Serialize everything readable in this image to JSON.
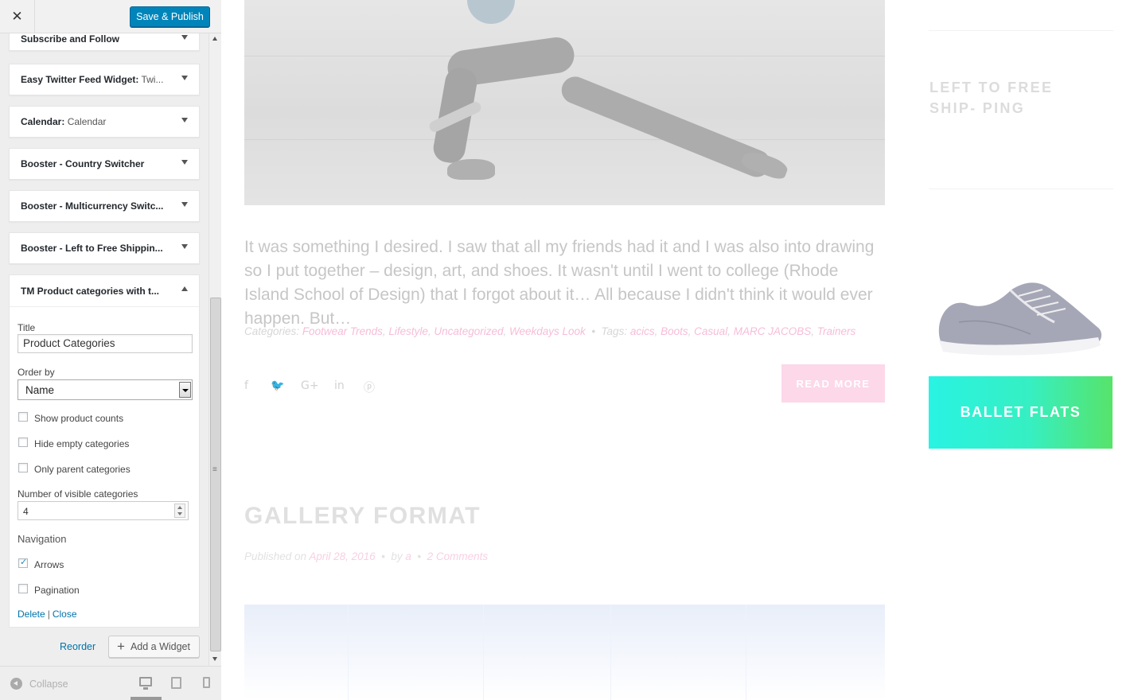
{
  "header": {
    "close_glyph": "✕",
    "save_label": "Save & Publish"
  },
  "widgets": [
    {
      "title": "Subscribe and Follow",
      "sub": ""
    },
    {
      "title": "Easy Twitter Feed Widget:",
      "sub": " Twi..."
    },
    {
      "title": "Calendar:",
      "sub": " Calendar"
    },
    {
      "title": "Booster - Country Switcher",
      "sub": ""
    },
    {
      "title": "Booster - Multicurrency Switc...",
      "sub": ""
    },
    {
      "title": "Booster - Left to Free Shippin...",
      "sub": ""
    }
  ],
  "open_widget": {
    "title": "TM Product categories with t...",
    "title_label": "Title",
    "title_value": "Product Categories",
    "order_label": "Order by",
    "order_value": "Name",
    "checkboxes": [
      {
        "label": "Show product counts",
        "checked": false
      },
      {
        "label": "Hide empty categories",
        "checked": false
      },
      {
        "label": "Only parent categories",
        "checked": false
      }
    ],
    "visible_label": "Number of visible categories",
    "visible_value": "4",
    "nav_heading": "Navigation",
    "nav_options": [
      {
        "label": "Arrows",
        "checked": true
      },
      {
        "label": "Pagination",
        "checked": false
      }
    ],
    "delete_label": "Delete",
    "separator": "|",
    "close_label": "Close"
  },
  "actions": {
    "reorder_label": "Reorder",
    "add_widget_label": "Add a Widget",
    "add_glyph": "+"
  },
  "footer": {
    "collapse_label": "Collapse",
    "device_icons": [
      "desktop-icon",
      "tablet-icon",
      "mobile-icon"
    ]
  },
  "post": {
    "excerpt": "It was something I desired. I saw that all my friends had it and I was also into drawing so I put together – design, art, and shoes. It wasn't until I went to college (Rhode Island School of Design) that I forgot about it… All because I didn't think it would ever happen. But…",
    "categories_label": "Categories:",
    "categories": [
      "Footwear Trends",
      "Lifestyle",
      "Uncategorized",
      "Weekdays Look"
    ],
    "tags_label": "Tags:",
    "tags": [
      "acics",
      "Boots",
      "Casual",
      "MARC JACOBS",
      "Trainers"
    ],
    "social_icons": [
      "facebook-icon",
      "twitter-icon",
      "google-plus-icon",
      "linkedin-icon",
      "pinterest-icon"
    ],
    "social_glyphs": [
      "f",
      "🐦",
      "G+",
      "in",
      "ⓟ"
    ],
    "read_more": "READ MORE"
  },
  "gallery": {
    "title": "GALLERY FORMAT",
    "published_label": "Published on",
    "date": "April 28, 2016",
    "by_label": "by",
    "author": "a",
    "comments": "2 Comments"
  },
  "right_col": {
    "shipping_text": "LEFT TO FREE SHIP- PING",
    "ballet_label": "BALLET FLATS"
  },
  "colors": {
    "primary_button": "#0085ba",
    "link": "#0073aa",
    "pink_accent": "#f6bdd8",
    "ballet_gradient_start": "#29f3e3",
    "ballet_gradient_end": "#57e36a"
  }
}
